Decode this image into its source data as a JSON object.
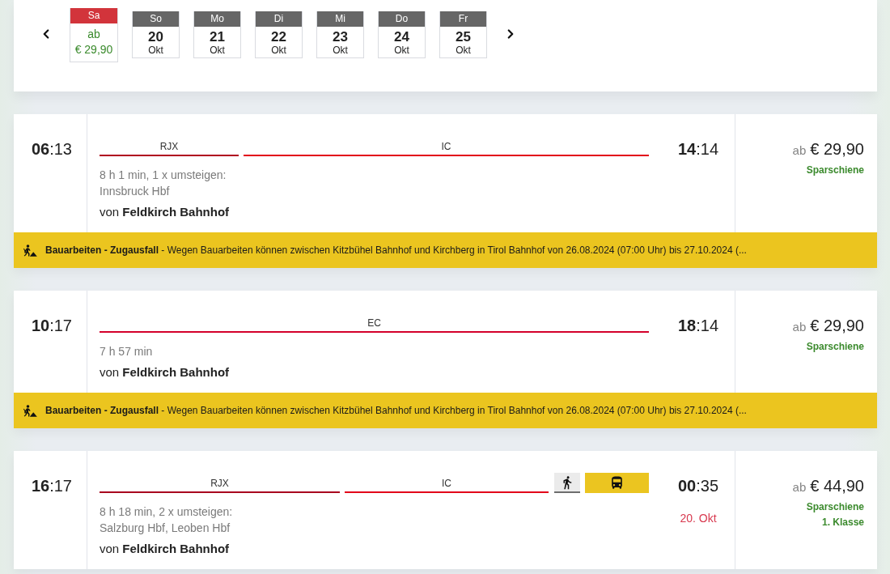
{
  "date_strip": {
    "days": [
      {
        "weekday": "Sa",
        "selected": true,
        "price_prefix": "ab",
        "price": "€ 29,90"
      },
      {
        "weekday": "So",
        "day": "20",
        "month": "Okt",
        "selected": false
      },
      {
        "weekday": "Mo",
        "day": "21",
        "month": "Okt",
        "selected": false
      },
      {
        "weekday": "Di",
        "day": "22",
        "month": "Okt",
        "selected": false
      },
      {
        "weekday": "Mi",
        "day": "23",
        "month": "Okt",
        "selected": false
      },
      {
        "weekday": "Do",
        "day": "24",
        "month": "Okt",
        "selected": false
      },
      {
        "weekday": "Fr",
        "day": "25",
        "month": "Okt",
        "selected": false
      }
    ]
  },
  "connections": [
    {
      "departure": "**06**:13",
      "segments": [
        {
          "kind": "train",
          "label": "RJX",
          "color": "#b0001f"
        },
        {
          "kind": "train",
          "label": "IC",
          "color": "#e2001a"
        }
      ],
      "duration": "8 h 1 min, 1 x umsteigen:",
      "transfers": "Innsbruck Hbf",
      "origin": "von **Feldkirch Bahnhof**",
      "arrival": "**14**:14",
      "price_prefix": "ab",
      "price": "€ 29,90",
      "tariffs": [
        "Sparschiene"
      ],
      "notice": "**Bauarbeiten - Zugausfall** - Wegen Bauarbeiten können zwischen Kitzbühel Bahnhof und Kirchberg in Tirol Bahnhof von 26.08.2024 (07:00 Uhr) bis 27.10.2024 (..."
    },
    {
      "departure": "**10**:17",
      "segments": [
        {
          "kind": "train",
          "label": "EC",
          "color": "#d4002b"
        }
      ],
      "duration": "7 h 57 min",
      "origin": "von **Feldkirch Bahnhof**",
      "arrival": "**18**:14",
      "price_prefix": "ab",
      "price": "€ 29,90",
      "tariffs": [
        "Sparschiene"
      ],
      "notice": "**Bauarbeiten - Zugausfall** - Wegen Bauarbeiten können zwischen Kitzbühel Bahnhof und Kirchberg in Tirol Bahnhof von 26.08.2024 (07:00 Uhr) bis 27.10.2024 (..."
    },
    {
      "departure": "**16**:17",
      "segments": [
        {
          "kind": "train",
          "label": "RJX",
          "color": "#a8001e"
        },
        {
          "kind": "train",
          "label": "IC",
          "color": "#e2001a"
        },
        {
          "kind": "walk"
        },
        {
          "kind": "bus"
        }
      ],
      "duration": "8 h 18 min, 2 x umsteigen:",
      "transfers": "Salzburg Hbf, Leoben Hbf",
      "origin": "von **Feldkirch Bahnhof**",
      "arrival": "**00**:35",
      "arrival_date": "20. Okt",
      "price_prefix": "ab",
      "price": "€ 44,90",
      "tariffs": [
        "Sparschiene",
        "1. Klasse"
      ]
    }
  ]
}
